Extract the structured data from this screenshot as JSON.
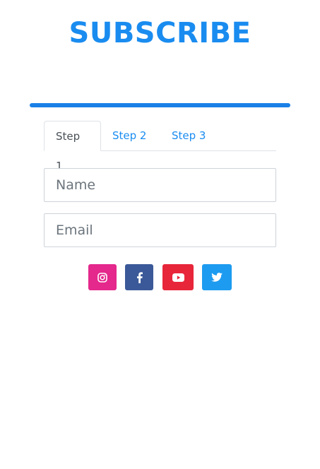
{
  "header": {
    "title": "SUBSCRIBE"
  },
  "tabs": [
    {
      "label": "Step 1",
      "active": true
    },
    {
      "label": "Step 2",
      "active": false
    },
    {
      "label": "Step 3",
      "active": false
    }
  ],
  "form": {
    "name_placeholder": "Name",
    "name_value": "",
    "email_placeholder": "Email",
    "email_value": ""
  },
  "socials": [
    {
      "icon": "instagram-icon",
      "color": "#e4288c"
    },
    {
      "icon": "facebook-icon",
      "color": "#3b5998"
    },
    {
      "icon": "youtube-icon",
      "color": "#e8263a"
    },
    {
      "icon": "twitter-icon",
      "color": "#1d9bf0"
    }
  ],
  "colors": {
    "accent": "#1a8cf0",
    "bar": "#1a80e6"
  }
}
